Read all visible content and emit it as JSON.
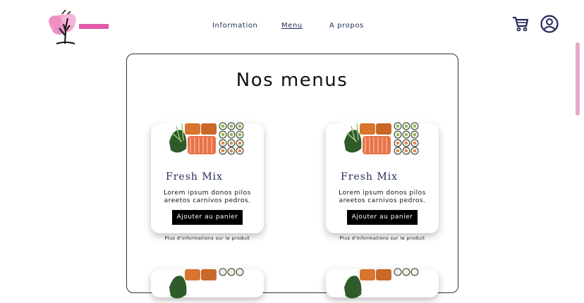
{
  "header": {
    "logo_alt": "TOKYO SUSHI",
    "nav": [
      {
        "label": "Information"
      },
      {
        "label": "Menu"
      },
      {
        "label": "A propos"
      }
    ],
    "cart_icon": "cart-icon",
    "account_icon": "user-circle-icon"
  },
  "main": {
    "title": "Nos menus",
    "cards": [
      {
        "title": "Fresh Mix",
        "description_line1": "Lorem ipsum donos pilos",
        "description_line2": "areetos carnivos pedros.",
        "button_label": "Ajouter au panier",
        "more_link": "Plus d'informations sur le produit"
      },
      {
        "title": "Fresh Mix",
        "description_line1": "Lorem ipsum donos pilos",
        "description_line2": "areetos carnivos pedros.",
        "button_label": "Ajouter au panier",
        "more_link": "Plus d'informations sur le produit"
      }
    ]
  },
  "colors": {
    "nav_text": "#1e2a5a",
    "accent_pink": "#e8a8cc",
    "button_bg": "#000000"
  }
}
